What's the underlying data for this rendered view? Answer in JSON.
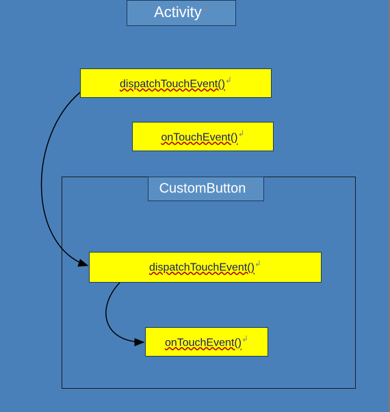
{
  "diagram": {
    "activity_label": "Activity",
    "custombutton_label": "CustomButton",
    "activity_dispatch": "dispatchTouchEvent()",
    "activity_ontouch": "onTouchEvent()",
    "custom_dispatch": "dispatchTouchEvent()",
    "custom_ontouch": "onTouchEvent()"
  }
}
